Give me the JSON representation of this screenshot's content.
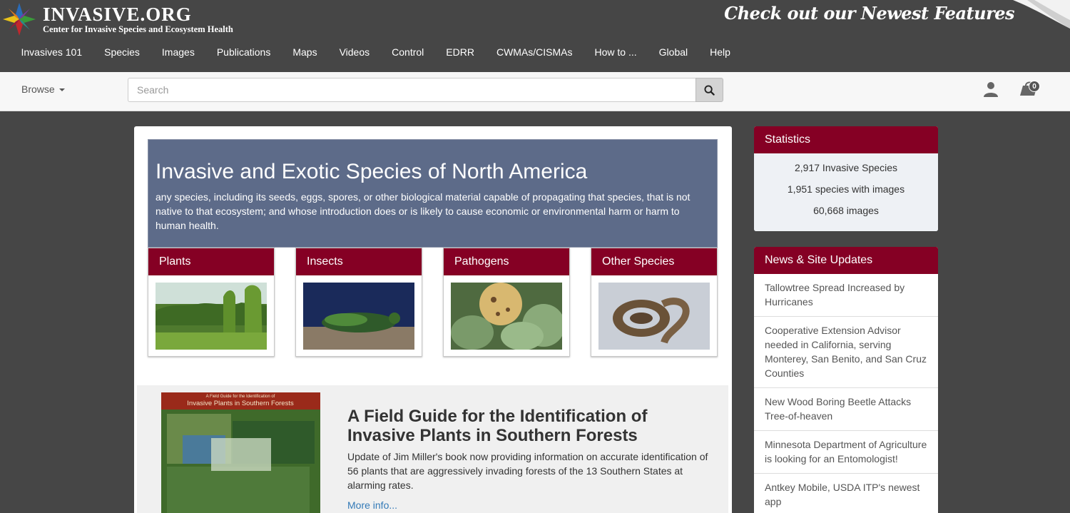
{
  "site": {
    "name": "INVASIVE.ORG",
    "subtitle": "Center for Invasive Species and Ecosystem Health",
    "features_banner": "Check out our Newest Features"
  },
  "nav": [
    {
      "label": "Invasives 101"
    },
    {
      "label": "Species"
    },
    {
      "label": "Images"
    },
    {
      "label": "Publications"
    },
    {
      "label": "Maps"
    },
    {
      "label": "Videos"
    },
    {
      "label": "Control"
    },
    {
      "label": "EDRR"
    },
    {
      "label": "CWMAs/CISMAs"
    },
    {
      "label": "How to ..."
    },
    {
      "label": "Global"
    },
    {
      "label": "Help"
    }
  ],
  "searchbar": {
    "browse_label": "Browse",
    "placeholder": "Search",
    "cart_count": "0"
  },
  "hero": {
    "title": "Invasive and Exotic Species of North America",
    "text": "any species, including its seeds, eggs, spores, or other biological material capable of propagating that species, that is not native to that ecosystem; and whose introduction does or is likely to cause economic or environmental harm or harm to human health."
  },
  "categories": [
    {
      "label": "Plants"
    },
    {
      "label": "Insects"
    },
    {
      "label": "Pathogens"
    },
    {
      "label": "Other Species"
    }
  ],
  "feature": {
    "book_cover_small": "A Field Guide for the Identification of",
    "book_cover_title": "Invasive Plants in Southern Forests",
    "title": "A Field Guide for the Identification of Invasive Plants in Southern Forests",
    "text": "Update of Jim Miller's book now providing information on accurate identification of 56 plants that are aggressively invading forests of the 13 Southern States at alarming rates.",
    "more": "More info..."
  },
  "statistics": {
    "heading": "Statistics",
    "items": [
      {
        "text": "2,917 Invasive Species"
      },
      {
        "text": "1,951 species with images"
      },
      {
        "text": "60,668 images"
      }
    ]
  },
  "news": {
    "heading": "News & Site Updates",
    "items": [
      {
        "text": "Tallowtree Spread Increased by Hurricanes"
      },
      {
        "text": "Cooperative Extension Advisor needed in California, serving Monterey, San Benito, and San Cruz Counties"
      },
      {
        "text": "New Wood Boring Beetle Attacks Tree-of-heaven"
      },
      {
        "text": "Minnesota Department of Agriculture is looking for an Entomologist!"
      },
      {
        "text": "Antkey Mobile, USDA ITP's newest app"
      }
    ]
  },
  "colors": {
    "header_bg": "#464646",
    "accent_maroon": "#850024",
    "hero_bg": "#5d6b89",
    "link_blue": "#337ab7"
  }
}
